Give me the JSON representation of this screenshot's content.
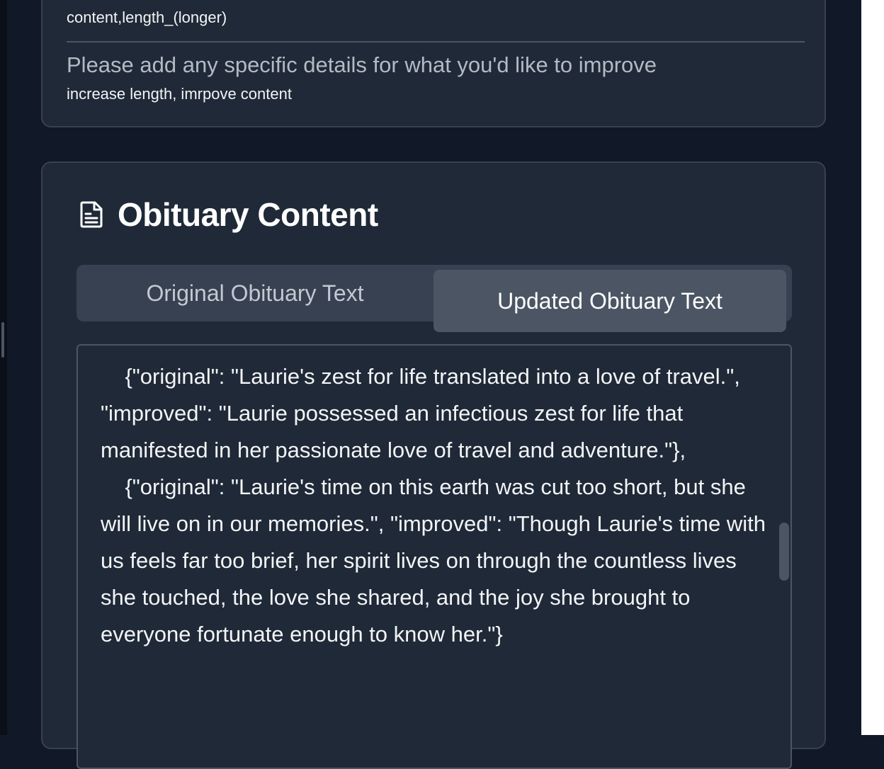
{
  "improvement_options": {
    "selected_value": "content,length_(longer)",
    "details_label": "Please add any specific details for what you'd like to improve",
    "details_value": "increase length, imrpove content"
  },
  "obituary_section": {
    "icon": "document-icon",
    "title": "Obituary Content",
    "tabs": [
      {
        "label": "Original Obituary Text",
        "active": false
      },
      {
        "label": "Updated Obituary Text",
        "active": true
      }
    ],
    "text_output": "    {\"original\": \"Laurie's zest for life translated into a love of travel.\", \"improved\": \"Laurie possessed an infectious zest for life that manifested in her passionate love of travel and adventure.\"},\n    {\"original\": \"Laurie's time on this earth was cut too short, but she will live on in our memories.\", \"improved\": \"Though Laurie's time with us feels far too brief, her spirit lives on through the countless lives she touched, the love she shared, and the joy she brought to everyone fortunate enough to know her.\"}"
  },
  "colors": {
    "page_background": "#111827",
    "card_background": "#1f2937",
    "card_border": "#374151",
    "tab_bar": "#374151",
    "active_tab": "#4b5563"
  }
}
